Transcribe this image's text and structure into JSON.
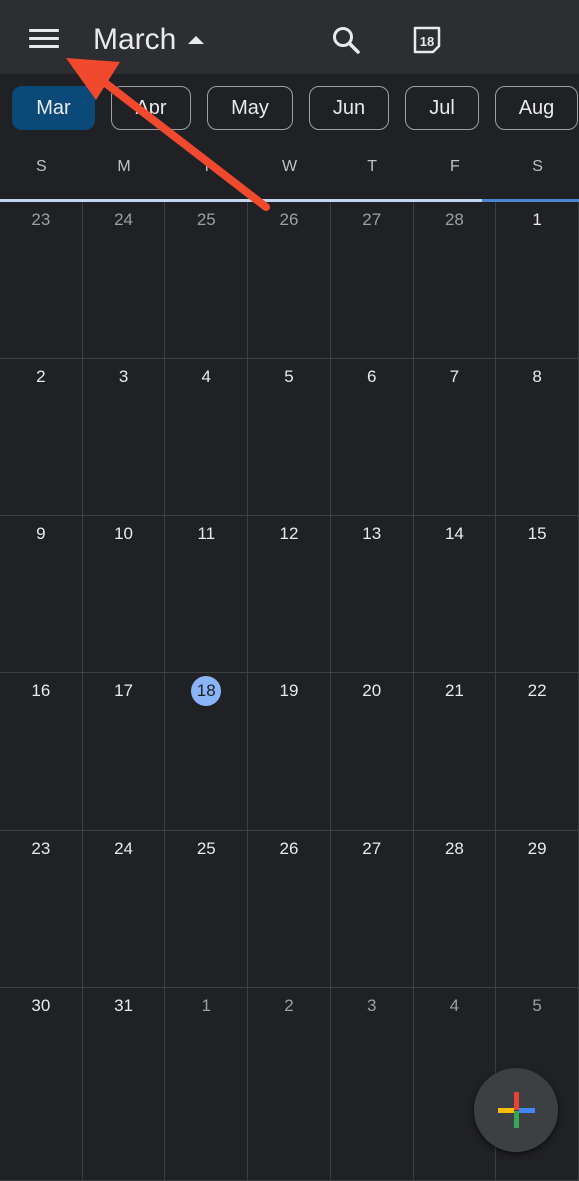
{
  "header": {
    "title": "March",
    "icons": {
      "menu": "menu-icon",
      "dropdown": "caret-up-icon",
      "search": "search-icon",
      "today": "today-calendar-icon"
    },
    "today_badge": "18"
  },
  "month_chips": [
    {
      "label": "Mar",
      "active": true
    },
    {
      "label": "Apr",
      "active": false
    },
    {
      "label": "May",
      "active": false
    },
    {
      "label": "Jun",
      "active": false
    },
    {
      "label": "Jul",
      "active": false
    },
    {
      "label": "Aug",
      "active": false
    }
  ],
  "weekdays": [
    "S",
    "M",
    "T",
    "W",
    "T",
    "F",
    "S"
  ],
  "weeks": [
    [
      "23",
      "24",
      "25",
      "26",
      "27",
      "28",
      "1"
    ],
    [
      "2",
      "3",
      "4",
      "5",
      "6",
      "7",
      "8"
    ],
    [
      "9",
      "10",
      "11",
      "12",
      "13",
      "14",
      "15"
    ],
    [
      "16",
      "17",
      "18",
      "19",
      "20",
      "21",
      "22"
    ],
    [
      "23",
      "24",
      "25",
      "26",
      "27",
      "28",
      "29"
    ],
    [
      "30",
      "31",
      "1",
      "2",
      "3",
      "4",
      "5"
    ]
  ],
  "today": "18",
  "fab": {
    "icon": "plus-multicolor-icon"
  },
  "colors": {
    "background": "#202124",
    "appbar": "#2d2e31",
    "active_chip": "#0b4a78",
    "today_circle": "#8ab4f8",
    "annotation_arrow": "#f0492e",
    "fab_plus_blue": "#4285f4",
    "fab_plus_red": "#ea4335",
    "fab_plus_yellow": "#fbbc04",
    "fab_plus_green": "#34a853"
  }
}
